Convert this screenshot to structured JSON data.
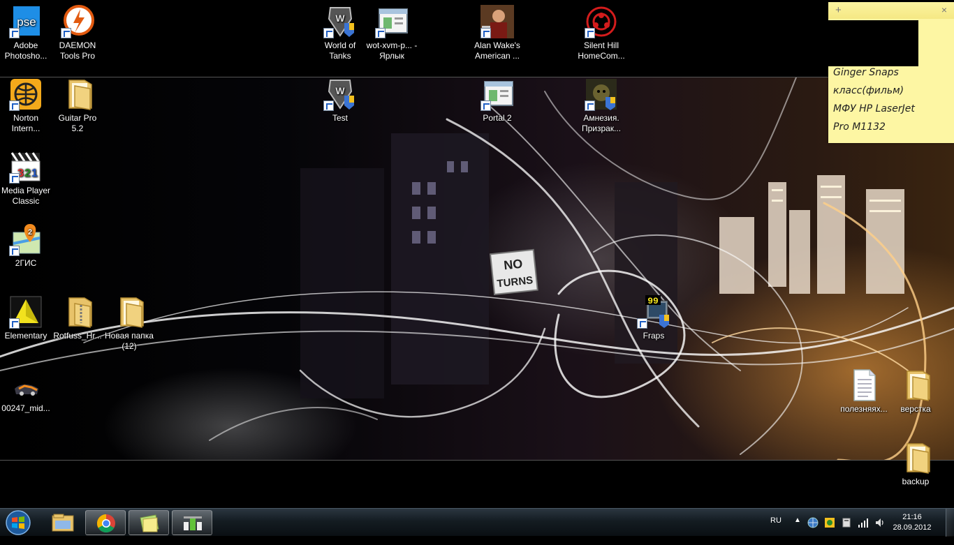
{
  "desktop_icons": [
    {
      "id": "adobe",
      "label": "Adobe Photosho...",
      "icon": "photoshop-icon"
    },
    {
      "id": "daemon",
      "label": "DAEMON Tools Pro",
      "icon": "daemon-tools-icon"
    },
    {
      "id": "wot",
      "label": "World of Tanks",
      "icon": "world-of-tanks-icon"
    },
    {
      "id": "wotxvm",
      "label": "wot-xvm-p... - Ярлык",
      "icon": "window-app-icon"
    },
    {
      "id": "alanwake",
      "label": "Alan Wake's American ...",
      "icon": "alan-wake-icon"
    },
    {
      "id": "silenthill",
      "label": "Silent Hill HomeCom...",
      "icon": "silent-hill-icon"
    },
    {
      "id": "norton",
      "label": "Norton Intern...",
      "icon": "norton-icon"
    },
    {
      "id": "guitarpro",
      "label": "Guitar Pro 5.2",
      "icon": "folder-icon"
    },
    {
      "id": "test",
      "label": "Test",
      "icon": "world-of-tanks-icon"
    },
    {
      "id": "portal2",
      "label": "Portal 2",
      "icon": "window-app-icon"
    },
    {
      "id": "amnesia",
      "label": "Амнезия. Призрак...",
      "icon": "amnesia-icon"
    },
    {
      "id": "mpc",
      "label": "Media Player Classic",
      "icon": "media-player-classic-icon"
    },
    {
      "id": "2gis",
      "label": "2ГИС",
      "icon": "2gis-icon"
    },
    {
      "id": "elementary",
      "label": "Elementary",
      "icon": "elementary-icon"
    },
    {
      "id": "rotfuss",
      "label": "Rotfuss_Hr...",
      "icon": "zip-folder-icon"
    },
    {
      "id": "newfolder",
      "label": "Новая папка (12)",
      "icon": "folder-icon"
    },
    {
      "id": "fraps",
      "label": "Fraps",
      "icon": "fraps-icon"
    },
    {
      "id": "file00247",
      "label": "00247_mid...",
      "icon": "image-file-icon"
    },
    {
      "id": "polezn",
      "label": "полезняях...",
      "icon": "text-document-icon"
    },
    {
      "id": "verstka",
      "label": "верстка",
      "icon": "folder-icon"
    },
    {
      "id": "backup",
      "label": "backup",
      "icon": "folder-icon"
    }
  ],
  "sticky_note": {
    "text": "Ginger Snaps\nкласс(фильм)\n МФУ HP LaserJet\nPro M1132",
    "new_note_glyph": "+",
    "close_glyph": "×",
    "background_color": "#fdf6a3"
  },
  "wallpaper": {
    "sign_text_1": "NO",
    "sign_text_2": "TURNS"
  },
  "taskbar": {
    "pinned": [
      {
        "id": "explorer",
        "icon": "windows-explorer-icon",
        "active": false
      },
      {
        "id": "chrome",
        "icon": "chrome-icon",
        "active": true
      },
      {
        "id": "sticky",
        "icon": "sticky-notes-icon",
        "active": true
      },
      {
        "id": "winamp",
        "icon": "app-icon",
        "active": true
      }
    ],
    "language": "RU",
    "clock_time": "21:16",
    "clock_date": "28.09.2012",
    "tray_icons": [
      "show-hidden-icons-arrow",
      "network-globe-icon",
      "app-tray-icon",
      "device-tray-icon",
      "signal-bars-icon",
      "volume-icon"
    ]
  },
  "colors": {
    "accent_taskbar": "#141c22",
    "shortcut_arrow": "#1f5fc4"
  }
}
